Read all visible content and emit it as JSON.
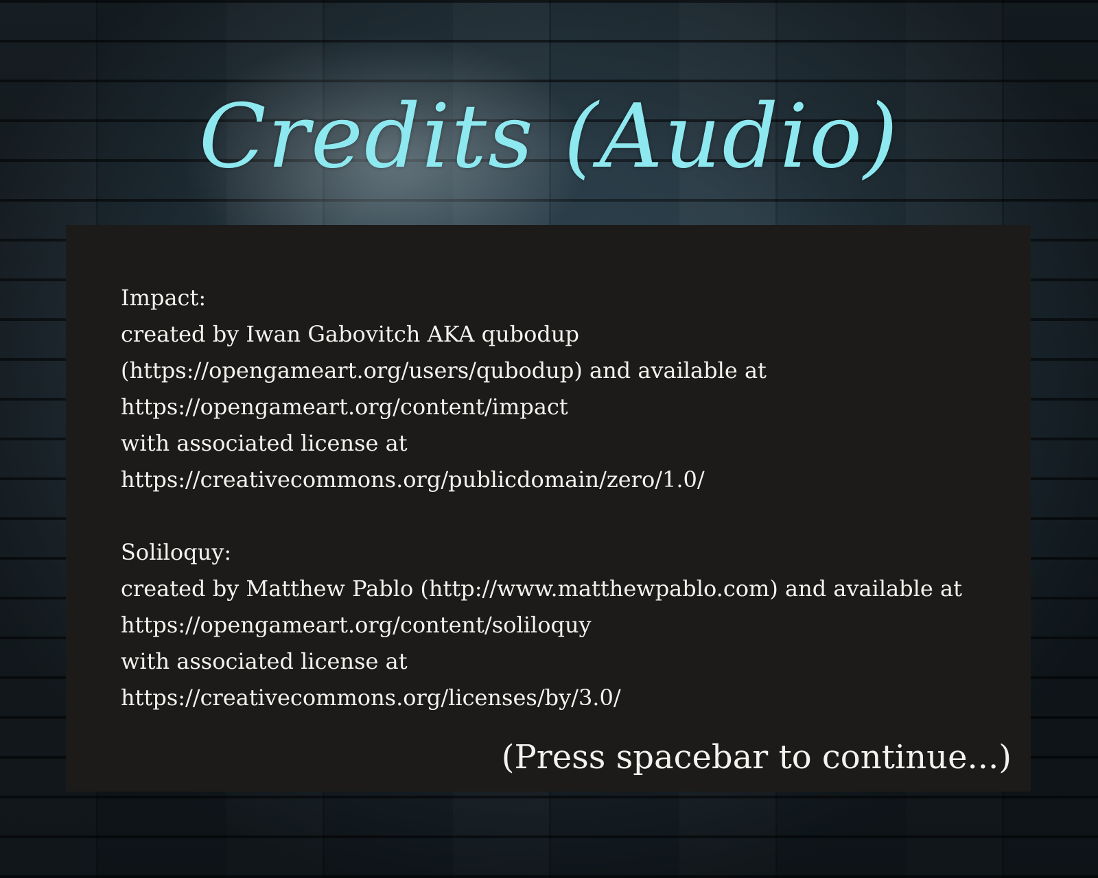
{
  "screen": {
    "title": "Credits (Audio)",
    "credits": [
      {
        "name": "Impact:",
        "lines": [
          "created by Iwan Gabovitch AKA qubodup",
          "(https://opengameart.org/users/qubodup) and available at",
          "https://opengameart.org/content/impact",
          "with associated license at",
          "https://creativecommons.org/publicdomain/zero/1.0/"
        ]
      },
      {
        "name": "Soliloquy:",
        "lines": [
          "created by Matthew Pablo (http://www.matthewpablo.com) and available at",
          "https://opengameart.org/content/soliloquy",
          "with associated license at",
          "https://creativecommons.org/licenses/by/3.0/"
        ]
      }
    ],
    "continue_prompt": "(Press spacebar to continue...)"
  },
  "colors": {
    "title": "#8ee8ef",
    "panel": "#1c1b1a",
    "text": "#f2f2ee"
  }
}
